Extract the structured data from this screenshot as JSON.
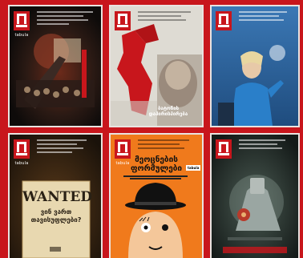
{
  "page": {
    "background": "#c8161c",
    "cover_border": "#e9e3e0"
  },
  "brand": {
    "logo_word": "tabula",
    "brand_color": "#c8161c"
  },
  "covers": [
    {
      "name": "cover-1",
      "scene": "theater-stage-dark",
      "headline": ""
    },
    {
      "name": "cover-2",
      "scene": "red-map-portrait",
      "headline": "ბატონის\nდაპირისპირება"
    },
    {
      "name": "cover-3",
      "scene": "woman-speaker-blue",
      "headline": ""
    },
    {
      "name": "cover-4",
      "scene": "wanted-poster",
      "headline": "WANTED",
      "subhead": "ვინ ვართ\nთავისუფლები?"
    },
    {
      "name": "cover-5",
      "scene": "orange-clockwork",
      "headline": "მეოცნების\nფორმულები",
      "badge": "tabula"
    },
    {
      "name": "cover-6",
      "scene": "robot-hand-dark",
      "headline": ""
    }
  ]
}
